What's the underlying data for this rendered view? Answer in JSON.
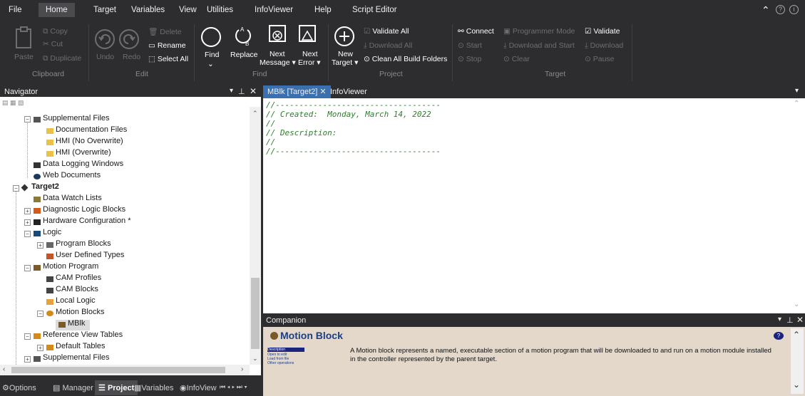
{
  "menu": [
    "File",
    "Home",
    "Target",
    "Variables",
    "View",
    "Utilities",
    "InfoViewer",
    "Help",
    "Script Editor"
  ],
  "ribbon": {
    "clipboard": {
      "paste": "Paste",
      "copy": "Copy",
      "cut": "Cut",
      "duplicate": "Duplicate",
      "group": "Clipboard"
    },
    "edit": {
      "undo": "Undo",
      "redo": "Redo",
      "delete": "Delete",
      "rename": "Rename",
      "select_all": "Select All",
      "group": "Edit"
    },
    "find": {
      "find": "Find",
      "replace": "Replace",
      "next_message": "Next",
      "next_message2": "Message",
      "next_error": "Next",
      "next_error2": "Error",
      "group": "Find"
    },
    "project": {
      "new_target": "New",
      "new_target2": "Target",
      "validate_all": "Validate All",
      "download_all": "Download All",
      "clean": "Clean All Build Folders",
      "group": "Project"
    },
    "target": {
      "connect": "Connect",
      "programmer_mode": "Programmer Mode",
      "validate": "Validate",
      "start": "Start",
      "download_start": "Download and Start",
      "download": "Download",
      "stop": "Stop",
      "clear": "Clear",
      "pause": "Pause",
      "group": "Target"
    }
  },
  "navigator": {
    "title": "Navigator",
    "items": [
      {
        "label": "Supplemental Files"
      },
      {
        "label": "Documentation Files"
      },
      {
        "label": "HMI (No Overwrite)"
      },
      {
        "label": "HMI (Overwrite)"
      },
      {
        "label": "Data Logging Windows"
      },
      {
        "label": "Web Documents"
      },
      {
        "label": "Target2"
      },
      {
        "label": "Data Watch Lists"
      },
      {
        "label": "Diagnostic Logic Blocks"
      },
      {
        "label": "Hardware Configuration *"
      },
      {
        "label": "Logic"
      },
      {
        "label": "Program Blocks"
      },
      {
        "label": "User Defined Types"
      },
      {
        "label": "Motion Program"
      },
      {
        "label": "CAM Profiles"
      },
      {
        "label": "CAM Blocks"
      },
      {
        "label": "Local Logic"
      },
      {
        "label": "Motion Blocks"
      },
      {
        "label": "MBlk"
      },
      {
        "label": "Reference View Tables"
      },
      {
        "label": "Default Tables"
      },
      {
        "label": "Supplemental Files"
      }
    ]
  },
  "bottom_tabs": [
    "Options",
    "Manager",
    "Project",
    "Variables",
    "InfoView"
  ],
  "editor": {
    "tabs": [
      "MBlk [Target2]",
      "InfoViewer"
    ],
    "lines": [
      "//-----------------------------------",
      "// Created:  Monday, March 14, 2022",
      "//",
      "// Description:",
      "//",
      "//-----------------------------------"
    ]
  },
  "companion": {
    "title": "Companion",
    "heading": "Motion Block",
    "links": [
      "Description",
      "Open to edit",
      "Load from file",
      "Other operations"
    ],
    "text": "A Motion block represents a named, executable section of a motion program that will be downloaded to and run on a motion module installed in the controller represented by the parent target."
  }
}
